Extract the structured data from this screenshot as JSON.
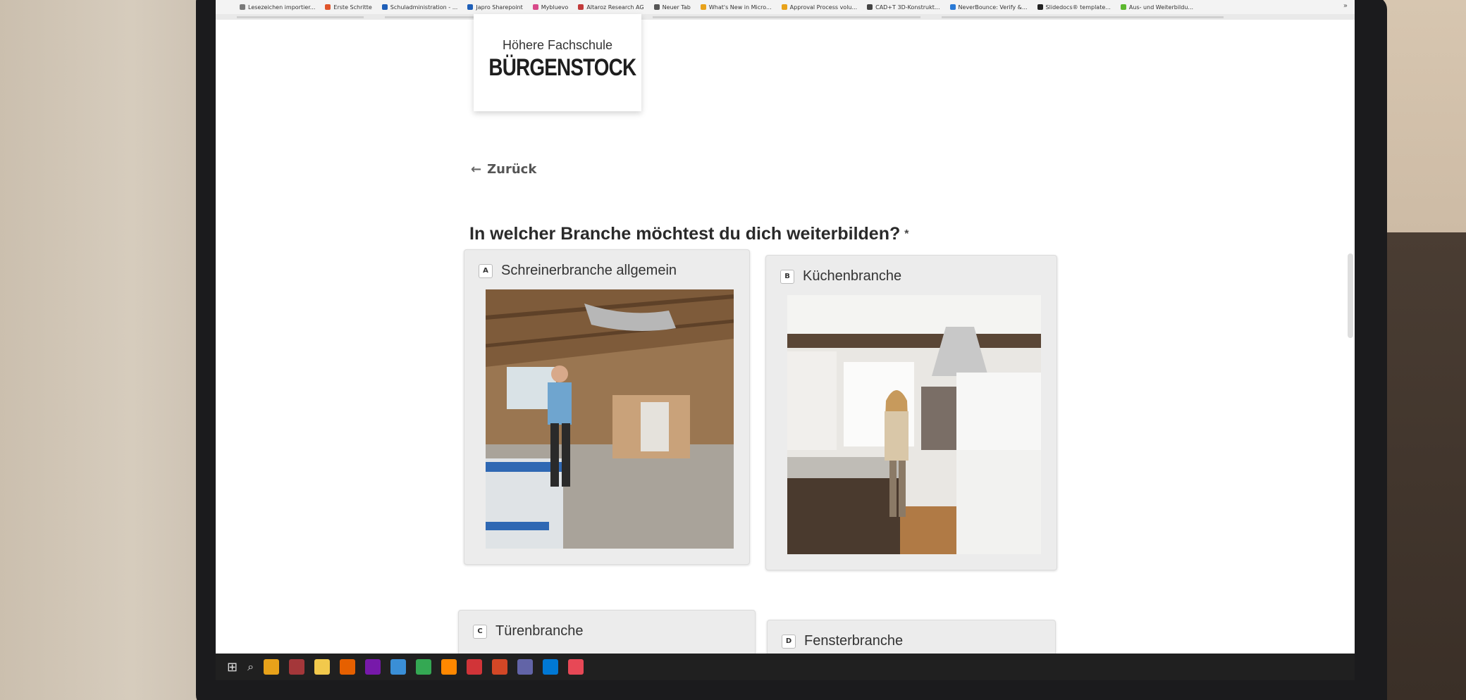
{
  "bookmarks": [
    {
      "label": "Lesezeichen importier...",
      "color": "#7a7a7a"
    },
    {
      "label": "Erste Schritte",
      "color": "#e0552b"
    },
    {
      "label": "Schuladministration - ...",
      "color": "#1f5fb8"
    },
    {
      "label": "Japro Sharepoint",
      "color": "#1f5fb8"
    },
    {
      "label": "Mybluevo",
      "color": "#d84a8a"
    },
    {
      "label": "Altaroz Research AG",
      "color": "#c23b3b"
    },
    {
      "label": "Neuer Tab",
      "color": "#555555"
    },
    {
      "label": "What's New in Micro...",
      "color": "#e8a21a"
    },
    {
      "label": "Approval Process volu...",
      "color": "#e8a21a"
    },
    {
      "label": "CAD+T 3D-Konstrukt...",
      "color": "#444444"
    },
    {
      "label": "NeverBounce: Verify &...",
      "color": "#2a7ad6"
    },
    {
      "label": "Slidedocs® template...",
      "color": "#222222"
    },
    {
      "label": "Aus- und Weiterbildu...",
      "color": "#5cb82e"
    }
  ],
  "logo": {
    "top": "Höhere Fachschule",
    "main": "BÜRGENSTOCK"
  },
  "back_label": "Zurück",
  "question": "In welcher Branche möchtest du dich weiterbilden?",
  "required_mark": "*",
  "options": [
    {
      "key": "A",
      "label": "Schreinerbranche allgemein"
    },
    {
      "key": "B",
      "label": "Küchenbranche"
    },
    {
      "key": "C",
      "label": "Türenbranche"
    },
    {
      "key": "D",
      "label": "Fensterbranche"
    }
  ],
  "taskbar_apps": [
    {
      "name": "explorer",
      "color": "#e8a21a"
    },
    {
      "name": "access",
      "color": "#a4373a"
    },
    {
      "name": "files",
      "color": "#f2c94c"
    },
    {
      "name": "firefox",
      "color": "#e66000"
    },
    {
      "name": "onenote",
      "color": "#7719aa"
    },
    {
      "name": "app",
      "color": "#3a8fd6"
    },
    {
      "name": "chrome",
      "color": "#34a853"
    },
    {
      "name": "vlc",
      "color": "#ff8800"
    },
    {
      "name": "app2",
      "color": "#d13438"
    },
    {
      "name": "powerpoint",
      "color": "#d24726"
    },
    {
      "name": "teams",
      "color": "#6264a7"
    },
    {
      "name": "photos",
      "color": "#0078d4"
    },
    {
      "name": "app3",
      "color": "#e74856"
    }
  ],
  "colors": {
    "card_bg": "#ececec",
    "taskbar": "#202020"
  }
}
